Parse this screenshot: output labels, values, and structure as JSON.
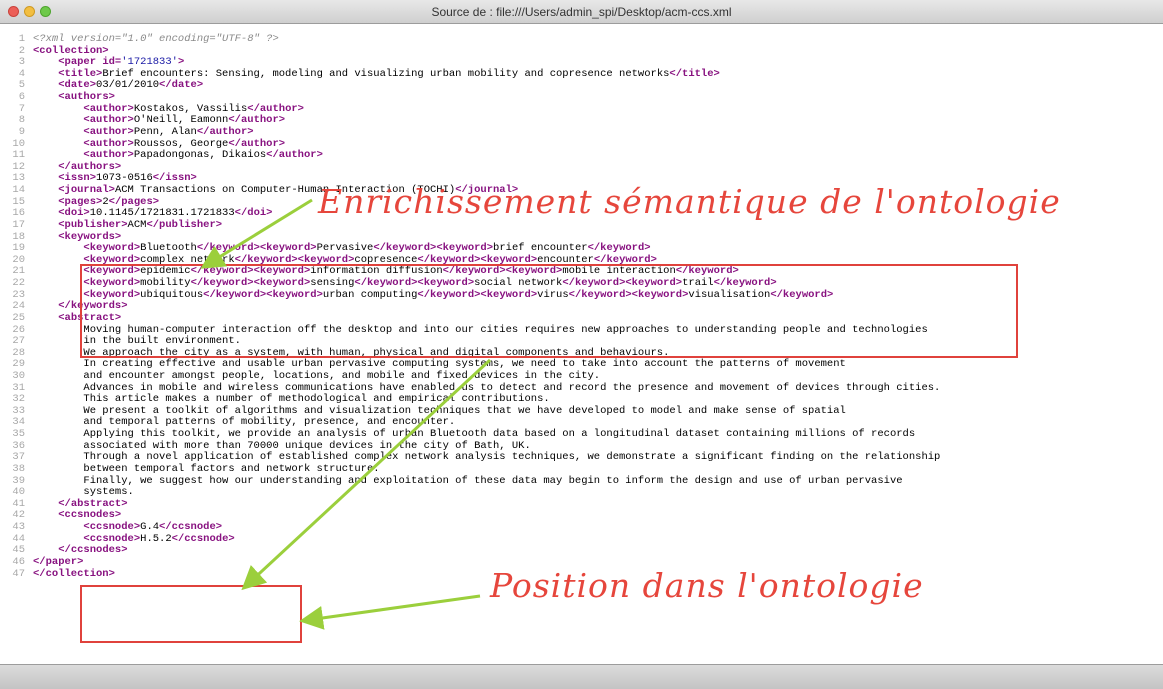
{
  "window": {
    "title": "Source de : file:///Users/admin_spi/Desktop/acm-ccs.xml"
  },
  "code_lines": [
    {
      "n": "1",
      "segs": [
        {
          "t": "<?xml version=\"1.0\" encoding=\"UTF-8\" ?>",
          "c": "decl"
        }
      ]
    },
    {
      "n": "2",
      "segs": [
        {
          "t": "<collection>",
          "c": "tag"
        }
      ]
    },
    {
      "n": "3",
      "segs": [
        {
          "t": "    ",
          "c": "txt"
        },
        {
          "t": "<paper id=",
          "c": "tag"
        },
        {
          "t": "'1721833'",
          "c": "val"
        },
        {
          "t": ">",
          "c": "tag"
        }
      ]
    },
    {
      "n": "4",
      "segs": [
        {
          "t": "    ",
          "c": "txt"
        },
        {
          "t": "<title>",
          "c": "tag"
        },
        {
          "t": "Brief encounters: Sensing, modeling and visualizing urban mobility and copresence networks",
          "c": "txt"
        },
        {
          "t": "</title>",
          "c": "tag"
        }
      ]
    },
    {
      "n": "5",
      "segs": [
        {
          "t": "    ",
          "c": "txt"
        },
        {
          "t": "<date>",
          "c": "tag"
        },
        {
          "t": "03/01/2010",
          "c": "txt"
        },
        {
          "t": "</date>",
          "c": "tag"
        }
      ]
    },
    {
      "n": "6",
      "segs": [
        {
          "t": "    ",
          "c": "txt"
        },
        {
          "t": "<authors>",
          "c": "tag"
        }
      ]
    },
    {
      "n": "7",
      "segs": [
        {
          "t": "        ",
          "c": "txt"
        },
        {
          "t": "<author>",
          "c": "tag"
        },
        {
          "t": "Kostakos, Vassilis",
          "c": "txt"
        },
        {
          "t": "</author>",
          "c": "tag"
        }
      ]
    },
    {
      "n": "8",
      "segs": [
        {
          "t": "        ",
          "c": "txt"
        },
        {
          "t": "<author>",
          "c": "tag"
        },
        {
          "t": "O'Neill, Eamonn",
          "c": "txt"
        },
        {
          "t": "</author>",
          "c": "tag"
        }
      ]
    },
    {
      "n": "9",
      "segs": [
        {
          "t": "        ",
          "c": "txt"
        },
        {
          "t": "<author>",
          "c": "tag"
        },
        {
          "t": "Penn, Alan",
          "c": "txt"
        },
        {
          "t": "</author>",
          "c": "tag"
        }
      ]
    },
    {
      "n": "10",
      "segs": [
        {
          "t": "        ",
          "c": "txt"
        },
        {
          "t": "<author>",
          "c": "tag"
        },
        {
          "t": "Roussos, George",
          "c": "txt"
        },
        {
          "t": "</author>",
          "c": "tag"
        }
      ]
    },
    {
      "n": "11",
      "segs": [
        {
          "t": "        ",
          "c": "txt"
        },
        {
          "t": "<author>",
          "c": "tag"
        },
        {
          "t": "Papadongonas, Dikaios",
          "c": "txt"
        },
        {
          "t": "</author>",
          "c": "tag"
        }
      ]
    },
    {
      "n": "12",
      "segs": [
        {
          "t": "    ",
          "c": "txt"
        },
        {
          "t": "</authors>",
          "c": "tag"
        }
      ]
    },
    {
      "n": "13",
      "segs": [
        {
          "t": "    ",
          "c": "txt"
        },
        {
          "t": "<issn>",
          "c": "tag"
        },
        {
          "t": "1073-0516",
          "c": "txt"
        },
        {
          "t": "</issn>",
          "c": "tag"
        }
      ]
    },
    {
      "n": "14",
      "segs": [
        {
          "t": "    ",
          "c": "txt"
        },
        {
          "t": "<journal>",
          "c": "tag"
        },
        {
          "t": "ACM Transactions on Computer-Human Interaction (TOCHI)",
          "c": "txt"
        },
        {
          "t": "</journal>",
          "c": "tag"
        }
      ]
    },
    {
      "n": "15",
      "segs": [
        {
          "t": "    ",
          "c": "txt"
        },
        {
          "t": "<pages>",
          "c": "tag"
        },
        {
          "t": "2",
          "c": "txt"
        },
        {
          "t": "</pages>",
          "c": "tag"
        }
      ]
    },
    {
      "n": "16",
      "segs": [
        {
          "t": "    ",
          "c": "txt"
        },
        {
          "t": "<doi>",
          "c": "tag"
        },
        {
          "t": "10.1145/1721831.1721833",
          "c": "txt"
        },
        {
          "t": "</doi>",
          "c": "tag"
        }
      ]
    },
    {
      "n": "17",
      "segs": [
        {
          "t": "    ",
          "c": "txt"
        },
        {
          "t": "<publisher>",
          "c": "tag"
        },
        {
          "t": "ACM",
          "c": "txt"
        },
        {
          "t": "</publisher>",
          "c": "tag"
        }
      ]
    },
    {
      "n": "18",
      "segs": [
        {
          "t": "    ",
          "c": "txt"
        },
        {
          "t": "<keywords>",
          "c": "tag"
        }
      ]
    },
    {
      "n": "19",
      "segs": [
        {
          "t": "        ",
          "c": "txt"
        },
        {
          "t": "<keyword>",
          "c": "tag"
        },
        {
          "t": "Bluetooth",
          "c": "txt"
        },
        {
          "t": "</keyword><keyword>",
          "c": "tag"
        },
        {
          "t": "Pervasive",
          "c": "txt"
        },
        {
          "t": "</keyword><keyword>",
          "c": "tag"
        },
        {
          "t": "brief encounter",
          "c": "txt"
        },
        {
          "t": "</keyword>",
          "c": "tag"
        }
      ]
    },
    {
      "n": "20",
      "segs": [
        {
          "t": "        ",
          "c": "txt"
        },
        {
          "t": "<keyword>",
          "c": "tag"
        },
        {
          "t": "complex network",
          "c": "txt"
        },
        {
          "t": "</keyword><keyword>",
          "c": "tag"
        },
        {
          "t": "copresence",
          "c": "txt"
        },
        {
          "t": "</keyword><keyword>",
          "c": "tag"
        },
        {
          "t": "encounter",
          "c": "txt"
        },
        {
          "t": "</keyword>",
          "c": "tag"
        }
      ]
    },
    {
      "n": "21",
      "segs": [
        {
          "t": "        ",
          "c": "txt"
        },
        {
          "t": "<keyword>",
          "c": "tag"
        },
        {
          "t": "epidemic",
          "c": "txt"
        },
        {
          "t": "</keyword><keyword>",
          "c": "tag"
        },
        {
          "t": "information diffusion",
          "c": "txt"
        },
        {
          "t": "</keyword><keyword>",
          "c": "tag"
        },
        {
          "t": "mobile interaction",
          "c": "txt"
        },
        {
          "t": "</keyword>",
          "c": "tag"
        }
      ]
    },
    {
      "n": "22",
      "segs": [
        {
          "t": "        ",
          "c": "txt"
        },
        {
          "t": "<keyword>",
          "c": "tag"
        },
        {
          "t": "mobility",
          "c": "txt"
        },
        {
          "t": "</keyword><keyword>",
          "c": "tag"
        },
        {
          "t": "sensing",
          "c": "txt"
        },
        {
          "t": "</keyword><keyword>",
          "c": "tag"
        },
        {
          "t": "social network",
          "c": "txt"
        },
        {
          "t": "</keyword><keyword>",
          "c": "tag"
        },
        {
          "t": "trail",
          "c": "txt"
        },
        {
          "t": "</keyword>",
          "c": "tag"
        }
      ]
    },
    {
      "n": "23",
      "segs": [
        {
          "t": "        ",
          "c": "txt"
        },
        {
          "t": "<keyword>",
          "c": "tag"
        },
        {
          "t": "ubiquitous",
          "c": "txt"
        },
        {
          "t": "</keyword><keyword>",
          "c": "tag"
        },
        {
          "t": "urban computing",
          "c": "txt"
        },
        {
          "t": "</keyword><keyword>",
          "c": "tag"
        },
        {
          "t": "virus",
          "c": "txt"
        },
        {
          "t": "</keyword><keyword>",
          "c": "tag"
        },
        {
          "t": "visualisation",
          "c": "txt"
        },
        {
          "t": "</keyword>",
          "c": "tag"
        }
      ]
    },
    {
      "n": "24",
      "segs": [
        {
          "t": "    ",
          "c": "txt"
        },
        {
          "t": "</keywords>",
          "c": "tag"
        }
      ]
    },
    {
      "n": "25",
      "segs": [
        {
          "t": "    ",
          "c": "txt"
        },
        {
          "t": "<abstract>",
          "c": "tag"
        }
      ]
    },
    {
      "n": "26",
      "segs": [
        {
          "t": "        Moving human-computer interaction off the desktop and into our cities requires new approaches to understanding people and technologies",
          "c": "txt"
        }
      ]
    },
    {
      "n": "27",
      "segs": [
        {
          "t": "        in the built environment.",
          "c": "txt"
        }
      ]
    },
    {
      "n": "28",
      "segs": [
        {
          "t": "        We approach the city as a system, with human, physical and digital components and behaviours.",
          "c": "txt"
        }
      ]
    },
    {
      "n": "29",
      "segs": [
        {
          "t": "        In creating effective and usable urban pervasive computing systems, we need to take into account the patterns of movement",
          "c": "txt"
        }
      ]
    },
    {
      "n": "30",
      "segs": [
        {
          "t": "        and encounter amongst people, locations, and mobile and fixed devices in the city.",
          "c": "txt"
        }
      ]
    },
    {
      "n": "31",
      "segs": [
        {
          "t": "        Advances in mobile and wireless communications have enabled us to detect and record the presence and movement of devices through cities.",
          "c": "txt"
        }
      ]
    },
    {
      "n": "32",
      "segs": [
        {
          "t": "        This article makes a number of methodological and empirical contributions.",
          "c": "txt"
        }
      ]
    },
    {
      "n": "33",
      "segs": [
        {
          "t": "        We present a toolkit of algorithms and visualization techniques that we have developed to model and make sense of spatial",
          "c": "txt"
        }
      ]
    },
    {
      "n": "34",
      "segs": [
        {
          "t": "        and temporal patterns of mobility, presence, and encounter.",
          "c": "txt"
        }
      ]
    },
    {
      "n": "35",
      "segs": [
        {
          "t": "        Applying this toolkit, we provide an analysis of urban Bluetooth data based on a longitudinal dataset containing millions of records",
          "c": "txt"
        }
      ]
    },
    {
      "n": "36",
      "segs": [
        {
          "t": "        associated with more than 70000 unique devices in the city of Bath, UK.",
          "c": "txt"
        }
      ]
    },
    {
      "n": "37",
      "segs": [
        {
          "t": "        Through a novel application of established complex network analysis techniques, we demonstrate a significant finding on the relationship",
          "c": "txt"
        }
      ]
    },
    {
      "n": "38",
      "segs": [
        {
          "t": "        between temporal factors and network structure.",
          "c": "txt"
        }
      ]
    },
    {
      "n": "39",
      "segs": [
        {
          "t": "        Finally, we suggest how our understanding and exploitation of these data may begin to inform the design and use of urban pervasive",
          "c": "txt"
        }
      ]
    },
    {
      "n": "40",
      "segs": [
        {
          "t": "        systems.",
          "c": "txt"
        }
      ]
    },
    {
      "n": "41",
      "segs": [
        {
          "t": "    ",
          "c": "txt"
        },
        {
          "t": "</abstract>",
          "c": "tag"
        }
      ]
    },
    {
      "n": "42",
      "segs": [
        {
          "t": "    ",
          "c": "txt"
        },
        {
          "t": "<ccsnodes>",
          "c": "tag"
        }
      ]
    },
    {
      "n": "43",
      "segs": [
        {
          "t": "        ",
          "c": "txt"
        },
        {
          "t": "<ccsnode>",
          "c": "tag"
        },
        {
          "t": "G.4",
          "c": "txt"
        },
        {
          "t": "</ccsnode>",
          "c": "tag"
        }
      ]
    },
    {
      "n": "44",
      "segs": [
        {
          "t": "        ",
          "c": "txt"
        },
        {
          "t": "<ccsnode>",
          "c": "tag"
        },
        {
          "t": "H.5.2",
          "c": "txt"
        },
        {
          "t": "</ccsnode>",
          "c": "tag"
        }
      ]
    },
    {
      "n": "45",
      "segs": [
        {
          "t": "    ",
          "c": "txt"
        },
        {
          "t": "</ccsnodes>",
          "c": "tag"
        }
      ]
    },
    {
      "n": "46",
      "segs": [
        {
          "t": "</paper>",
          "c": "tag"
        }
      ]
    },
    {
      "n": "47",
      "segs": [
        {
          "t": "</collection>",
          "c": "tag"
        }
      ]
    }
  ],
  "annotations": {
    "enrichment": "Enrichissement sémantique de l'ontologie",
    "position": "Position dans l'ontologie"
  },
  "colors": {
    "tag": "#881280",
    "annotation": "#e6463c",
    "arrow": "#9bcf3c",
    "highlight_box": "#e0423c"
  }
}
